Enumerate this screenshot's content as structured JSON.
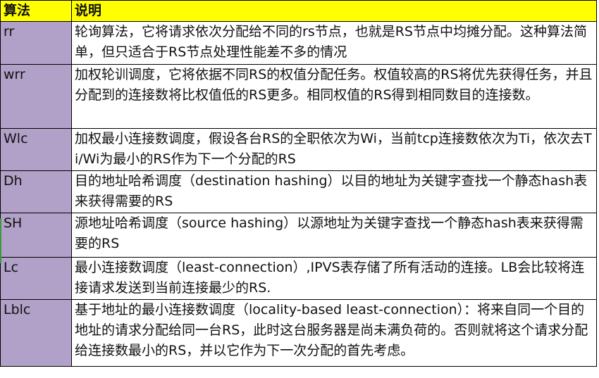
{
  "header": {
    "col_algo": "算法",
    "col_desc": "说明"
  },
  "rows": [
    {
      "algo": "rr",
      "desc": "轮询算法，它将请求依次分配给不同的rs节点，也就是RS节点中均摊分配。这种算法简单，但只适合于RS节点处理性能差不多的情况"
    },
    {
      "algo": "wrr",
      "desc": "加权轮训调度，它将依据不同RS的权值分配任务。权值较高的RS将优先获得任务，并且分配到的连接数将比权值低的RS更多。相同权值的RS得到相同数目的连接数。"
    },
    {
      "algo": "Wlc",
      "desc": "加权最小连接数调度，假设各台RS的全职依次为Wi，当前tcp连接数依次为Ti，依次去Ti/Wi为最小的RS作为下一个分配的RS"
    },
    {
      "algo": "Dh",
      "desc": "目的地址哈希调度（destination hashing）以目的地址为关键字查找一个静态hash表来获得需要的RS"
    },
    {
      "algo": "SH",
      "desc": "源地址哈希调度（source hashing）以源地址为关键字查找一个静态hash表来获得需要的RS"
    },
    {
      "algo": "Lc",
      "desc": "最小连接数调度（least-connection）,IPVS表存储了所有活动的连接。LB会比较将连接请求发送到当前连接最少的RS."
    },
    {
      "algo": "Lblc",
      "desc": "基于地址的最小连接数调度（locality-based least-connection）：将来自同一个目的地址的请求分配给同一台RS，此时这台服务器是尚未满负荷的。否则就将这个请求分配给连接数最小的RS，并以它作为下一次分配的首先考虑。"
    }
  ],
  "colors": {
    "header_bg": "#ffff00",
    "algo_col_bg": "#b1a0c7",
    "border": "#000000"
  }
}
